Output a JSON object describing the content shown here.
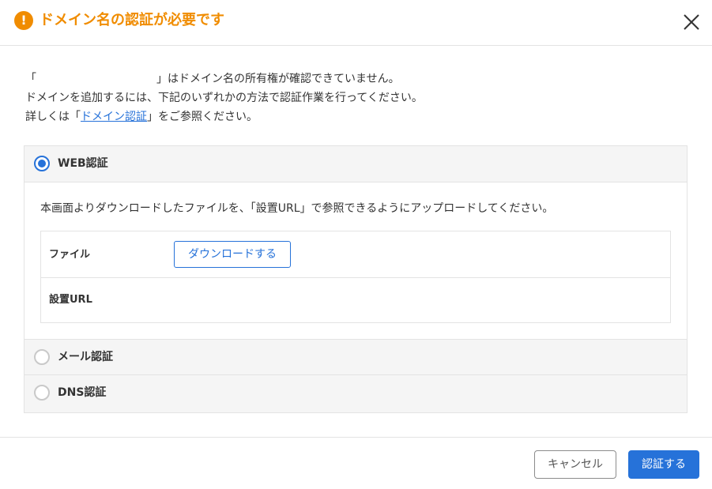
{
  "dialog": {
    "title": "ドメイン名の認証が必要です",
    "warning_icon_glyph": "!",
    "icons": {
      "title": "warning-icon",
      "close": "close-icon"
    },
    "colors": {
      "title": "#f08c00",
      "accent": "#2672d9"
    }
  },
  "intro": {
    "line1_open": "「",
    "line1_close": "」はドメイン名の所有権が確認できていません。",
    "line2": "ドメインを追加するには、下記のいずれかの方法で認証作業を行ってください。",
    "line3_prefix": "詳しくは「",
    "line3_link": "ドメイン認証",
    "line3_suffix": "」をご参照ください。"
  },
  "options": [
    {
      "label": "WEB認証",
      "selected": true,
      "description": "本画面よりダウンロードしたファイルを、「設置URL」で参照できるようにアップロードしてください。",
      "rows": [
        {
          "label": "ファイル",
          "button": "ダウンロードする"
        },
        {
          "label": "設置URL",
          "value": ""
        }
      ]
    },
    {
      "label": "メール認証",
      "selected": false
    },
    {
      "label": "DNS認証",
      "selected": false
    }
  ],
  "footer": {
    "cancel_label": "キャンセル",
    "confirm_label": "認証する"
  }
}
